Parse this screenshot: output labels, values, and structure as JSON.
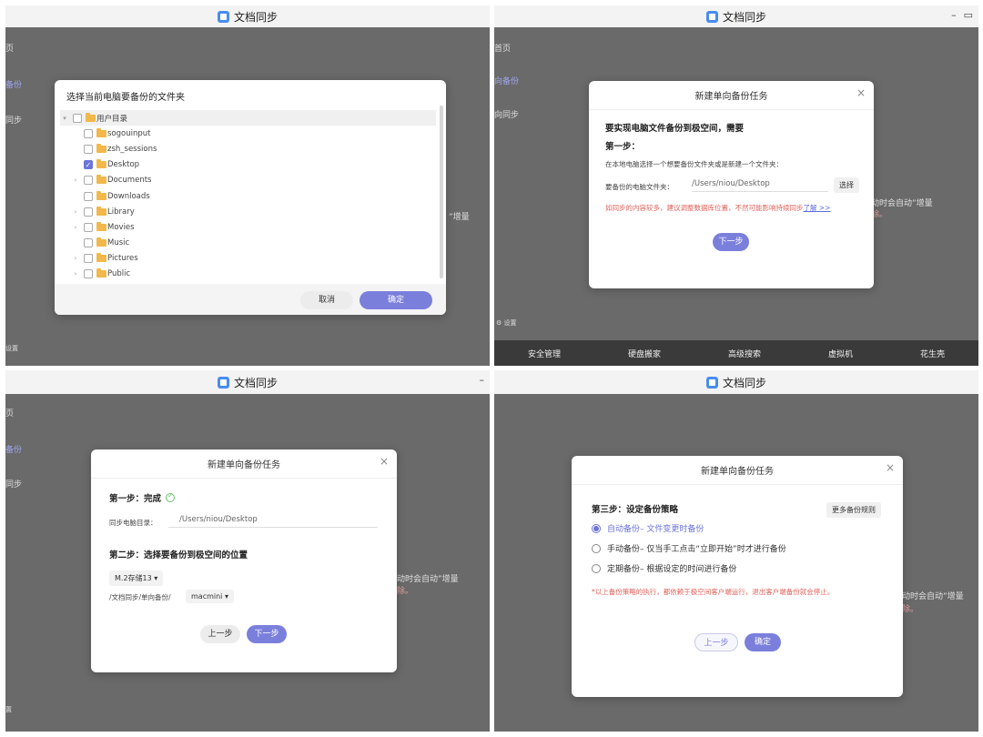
{
  "app_title": "文档同步",
  "panel1": {
    "sidebar": [
      "页",
      "备份",
      "同步"
    ],
    "sidebar_bottom": "设置",
    "bg_text": "”增量",
    "dialog": {
      "title": "选择当前电脑要备份的文件夹",
      "root": "用户目录",
      "items": [
        {
          "name": "sogouinput",
          "expandable": false,
          "checked": false
        },
        {
          "name": "zsh_sessions",
          "expandable": false,
          "checked": false
        },
        {
          "name": "Desktop",
          "expandable": false,
          "checked": true
        },
        {
          "name": "Documents",
          "expandable": true,
          "checked": false
        },
        {
          "name": "Downloads",
          "expandable": false,
          "checked": false
        },
        {
          "name": "Library",
          "expandable": true,
          "checked": false
        },
        {
          "name": "Movies",
          "expandable": true,
          "checked": false
        },
        {
          "name": "Music",
          "expandable": false,
          "checked": false
        },
        {
          "name": "Pictures",
          "expandable": true,
          "checked": false
        },
        {
          "name": "Public",
          "expandable": true,
          "checked": false
        }
      ],
      "cancel_label": "取消",
      "ok_label": "确定"
    }
  },
  "panel2": {
    "sidebar": [
      "首页",
      "向备份",
      "向同步"
    ],
    "settings_label": "设置",
    "bg_text1": "动时会自动”增量",
    "bg_text2": "除。",
    "bottom_nav": [
      "安全管理",
      "硬盘搬家",
      "高级搜索",
      "虚拟机",
      "花生壳"
    ],
    "dialog": {
      "title": "新建单向备份任务",
      "heading": "要实现电脑文件备份到极空间，需要",
      "step1": "第一步：",
      "instruction": "在本地电脑选择一个想要备份文件夹或是新建一个文件夹：",
      "folder_label": "要备份的电脑文件夹：",
      "folder_value": "/Users/niou/Desktop",
      "choose_label": "选择",
      "warning": "如同步的内容较多，建议调整数据库位置，不然可能影响持续同步",
      "learn_more": "了解 >>",
      "next_label": "下一步"
    }
  },
  "panel3": {
    "sidebar": [
      "页",
      "备份",
      "同步"
    ],
    "sidebar_bottom": "置",
    "bg_text1": "动时会自动”增量",
    "bg_text2": "除。",
    "dialog": {
      "title": "新建单向备份任务",
      "step1_done": "第一步：完成",
      "sync_dir_label": "同步电脑目录：",
      "sync_dir_value": "/Users/niou/Desktop",
      "step2": "第二步：选择要备份到极空间的位置",
      "storage": "M.2存储13",
      "path_prefix": "/文档同步/单向备份/",
      "path_folder": "macmini",
      "prev_label": "上一步",
      "next_label": "下一步"
    }
  },
  "panel4": {
    "bg_text1": "动时会自动”增量",
    "bg_text2": "除。",
    "dialog": {
      "title": "新建单向备份任务",
      "step3": "第三步：设定备份策略",
      "more_rules": "更多备份规则",
      "options": [
        {
          "name": "自动备份",
          "desc": " – 文件变更时备份",
          "selected": true
        },
        {
          "name": "手动备份",
          "desc": " – 仅当手工点击“立即开始”时才进行备份",
          "selected": false
        },
        {
          "name": "定期备份",
          "desc": " – 根据设定的时间进行备份",
          "selected": false
        }
      ],
      "note": "*以上备份策略的执行，都依赖于极空间客户端运行，退出客户端备份就会停止。",
      "prev_label": "上一步",
      "ok_label": "确定"
    }
  }
}
